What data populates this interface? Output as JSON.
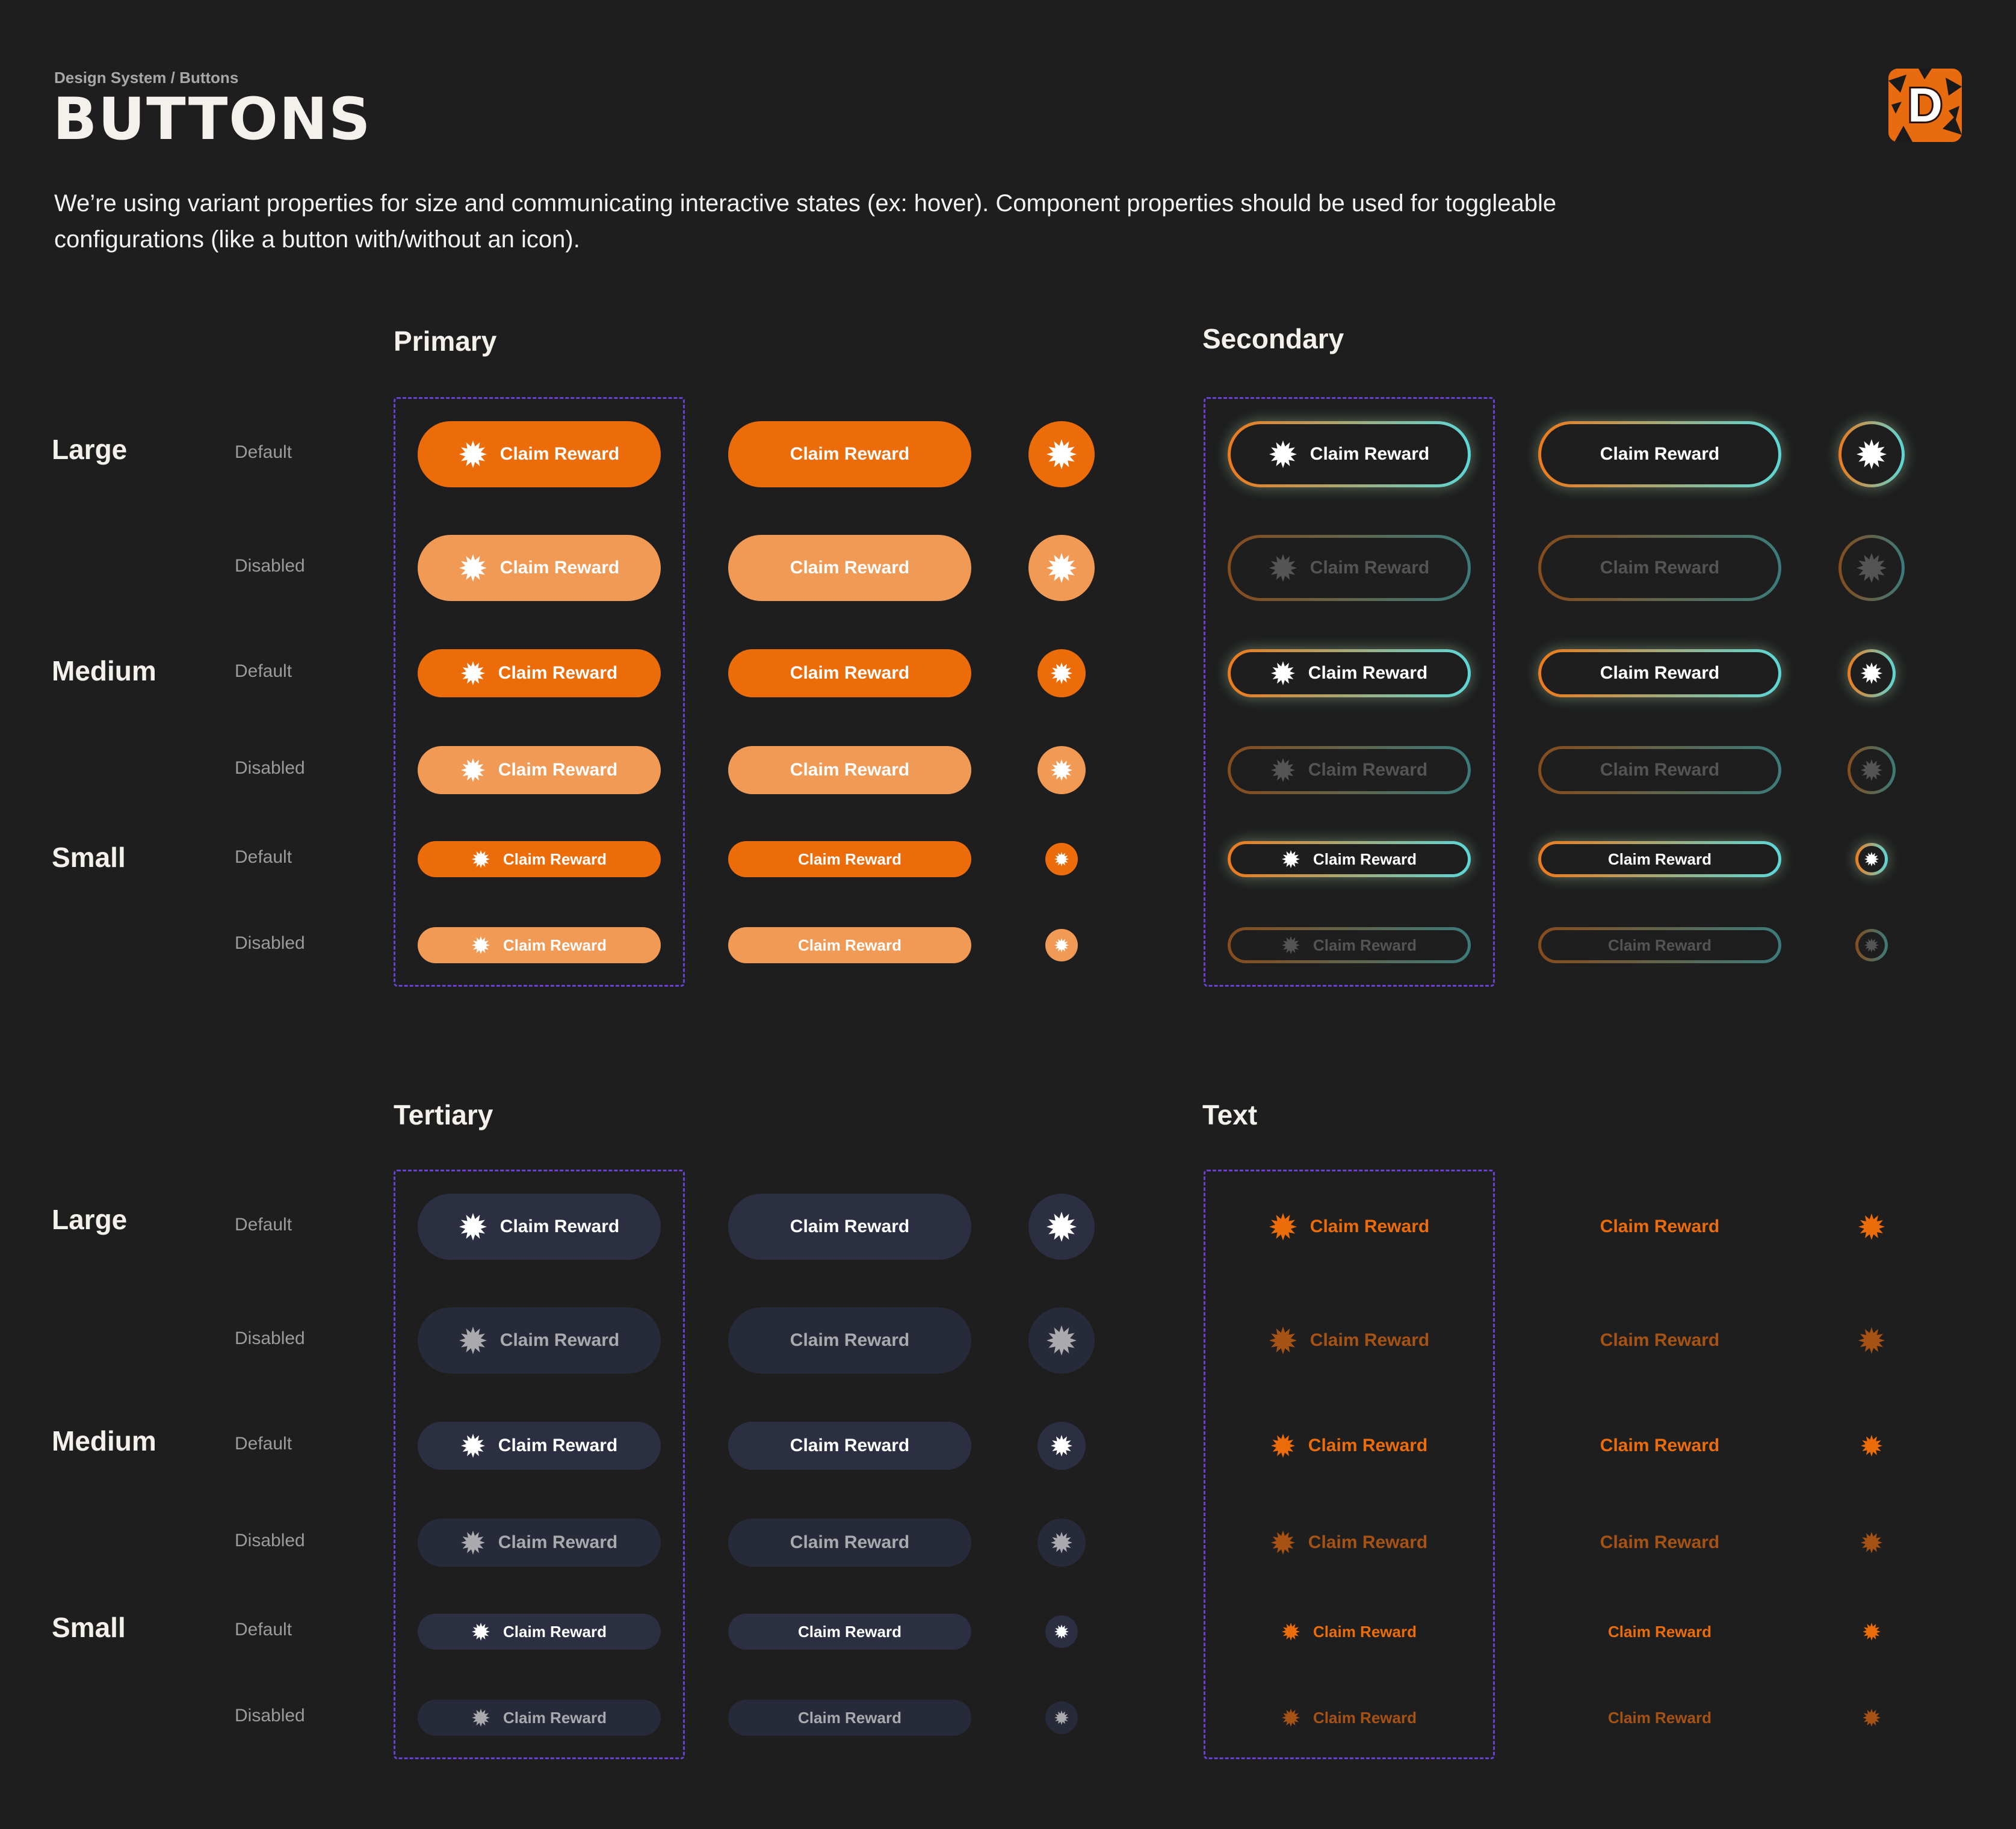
{
  "header": {
    "breadcrumb": "Design System / Buttons",
    "title": "BUTTONS",
    "description_line1": "We’re using variant properties for size and communicating interactive states (ex: hover). Component properties should be used for toggleable",
    "description_line2": "configurations (like a button with/without an icon)."
  },
  "logo": {
    "letter": "D",
    "icon": "brand-logo-icon"
  },
  "sections": {
    "primary": "Primary",
    "secondary": "Secondary",
    "tertiary": "Tertiary",
    "text": "Text"
  },
  "sizes": {
    "large": "Large",
    "medium": "Medium",
    "small": "Small"
  },
  "states": {
    "default": "Default",
    "disabled": "Disabled"
  },
  "button_label": "Claim Reward",
  "icon": "starburst-icon",
  "colors": {
    "background": "#1e1e1e",
    "primary": "#ec6c0a",
    "primary_disabled": "#f09a55",
    "secondary_border_start": "#ef7a1a",
    "secondary_border_end": "#5ad8d8",
    "tertiary": "#2c2f41",
    "text_accent": "#ec6c0a",
    "frame_border": "#6a3fd1",
    "label_gray": "#9b9b9b"
  }
}
